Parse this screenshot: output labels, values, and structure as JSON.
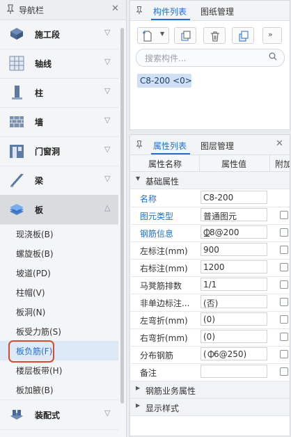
{
  "nav": {
    "title": "导航栏",
    "categories": [
      {
        "label": "施工段",
        "icon": "stage-icon"
      },
      {
        "label": "轴线",
        "icon": "grid-icon"
      },
      {
        "label": "柱",
        "icon": "column-icon"
      },
      {
        "label": "墙",
        "icon": "wall-icon"
      },
      {
        "label": "门窗洞",
        "icon": "door-window-icon"
      },
      {
        "label": "梁",
        "icon": "beam-icon"
      },
      {
        "label": "板",
        "icon": "slab-icon"
      },
      {
        "label": "装配式",
        "icon": "prefab-icon"
      }
    ],
    "slab_items": [
      "现浇板(B)",
      "螺旋板(B)",
      "坡道(PD)",
      "柱帽(V)",
      "板洞(N)",
      "板受力筋(S)",
      "板负筋(F)",
      "楼层板带(H)",
      "板加腋(B)"
    ],
    "selected_item": "板负筋(F)"
  },
  "component_panel": {
    "tabs": [
      "构件列表",
      "图纸管理"
    ],
    "search_placeholder": "搜索构件...",
    "item": "C8-200 <0>"
  },
  "property_panel": {
    "tabs": [
      "属性列表",
      "图层管理"
    ],
    "columns": [
      "属性名称",
      "属性值",
      "附加"
    ],
    "group_basic": "基础属性",
    "rows": [
      {
        "name": "名称",
        "value": "C8-200",
        "link": true,
        "check": false
      },
      {
        "name": "图元类型",
        "value": "普通图元",
        "link": true,
        "check": true
      },
      {
        "name": "钢筋信息",
        "value": " 8@200",
        "link": true,
        "check": true
      },
      {
        "name": "左标注(mm)",
        "value": "900",
        "link": false,
        "check": true
      },
      {
        "name": "右标注(mm)",
        "value": "1200",
        "link": false,
        "check": true
      },
      {
        "name": "马凳筋排数",
        "value": "1/1",
        "link": false,
        "check": true
      },
      {
        "name": "非单边标注...",
        "value": "(否)",
        "link": false,
        "check": true
      },
      {
        "name": "左弯折(mm)",
        "value": "(0)",
        "link": false,
        "check": true
      },
      {
        "name": "右弯折(mm)",
        "value": "(0)",
        "link": false,
        "check": true
      },
      {
        "name": "分布钢筋",
        "value": "( 6@250)",
        "link": false,
        "check": true
      },
      {
        "name": "备注",
        "value": "",
        "link": false,
        "check": true
      }
    ],
    "group_business": "钢筋业务属性",
    "group_display": "显示样式"
  },
  "colors": {
    "accent": "#1f6fd1",
    "highlight": "#d84a2b",
    "rebar_symbol": "#333333"
  }
}
